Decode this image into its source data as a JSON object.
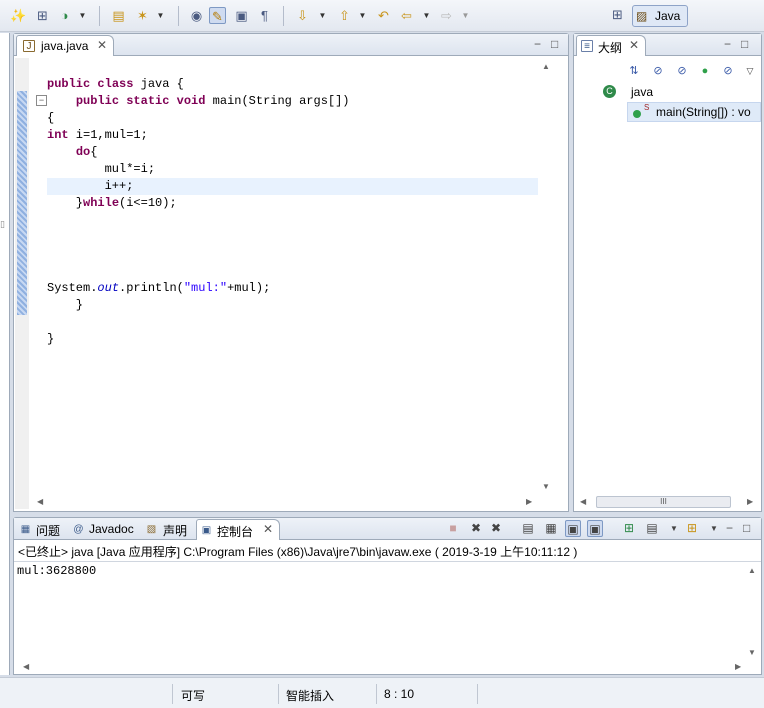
{
  "toolbar": {
    "icons": [
      "new-wizard-icon",
      "new-package-icon",
      "run-icon",
      "open-type-icon",
      "search-icon",
      "toggle-breakpoint-icon",
      "mark-occurrences-icon",
      "toggle-block-selection-icon",
      "show-whitespace-icon",
      "next-annotation-icon",
      "previous-annotation-icon",
      "last-edit-location-icon",
      "back-icon",
      "forward-icon"
    ],
    "perspective_label": "Java"
  },
  "editor": {
    "tab_title": "java.java",
    "code_lines": [
      "public class java {",
      "    public static void main(String args[])",
      "{",
      "int i=1,mul=1;",
      "    do{",
      "        mul*=i;",
      "        i++;",
      "    }while(i<=10);",
      "",
      "",
      "",
      "",
      "System.out.println(\"mul:\"+mul);",
      "    }",
      "",
      "}"
    ]
  },
  "outline": {
    "tab_title": "大纲",
    "class_name": "java",
    "method_name": "main(String[]) : vo",
    "static_mark": "S",
    "scroll_thumb": "III"
  },
  "console": {
    "tabs": [
      {
        "label": "问题",
        "icon": "problems-icon"
      },
      {
        "label": "Javadoc",
        "icon": "at-icon"
      },
      {
        "label": "声明",
        "icon": "declaration-icon"
      },
      {
        "label": "控制台",
        "icon": "console-icon"
      }
    ],
    "status": "<已终止> java [Java 应用程序] C:\\Program Files (x86)\\Java\\jre7\\bin\\javaw.exe ( 2019-3-19 上午10:11:12 )",
    "output": "mul:3628800"
  },
  "statusbar": {
    "writable": "可写",
    "insert_mode": "智能插入",
    "position": "8 : 10"
  }
}
